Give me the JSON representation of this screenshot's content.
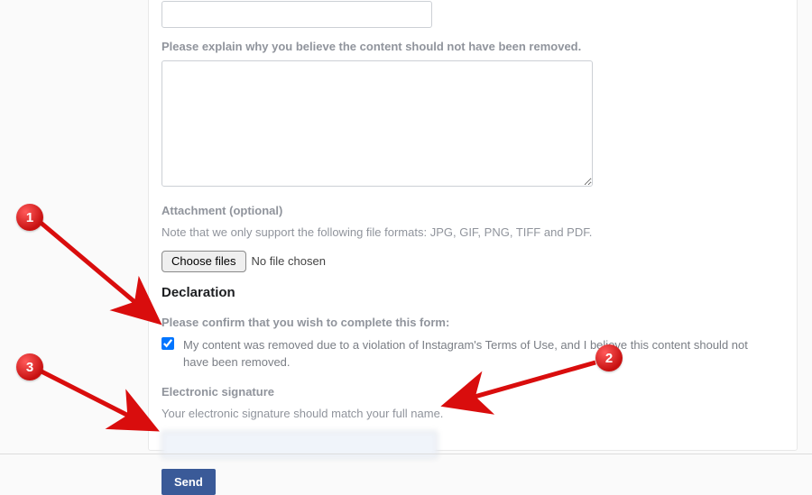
{
  "explain": {
    "label": "Please explain why you believe the content should not have been removed.",
    "value": ""
  },
  "attachment": {
    "label": "Attachment (optional)",
    "note": "Note that we only support the following file formats: JPG, GIF, PNG, TIFF and PDF.",
    "choose_label": "Choose files",
    "status": "No file chosen"
  },
  "declaration": {
    "heading": "Declaration",
    "confirm_label": "Please confirm that you wish to complete this form:",
    "checkbox_checked": true,
    "checkbox_text": "My content was removed due to a violation of Instagram's Terms of Use, and I believe this content should not have been removed."
  },
  "signature": {
    "label": "Electronic signature",
    "hint": "Your electronic signature should match your full name.",
    "value": " "
  },
  "submit": {
    "label": "Send"
  },
  "annotations": {
    "m1": "1",
    "m2": "2",
    "m3": "3"
  }
}
